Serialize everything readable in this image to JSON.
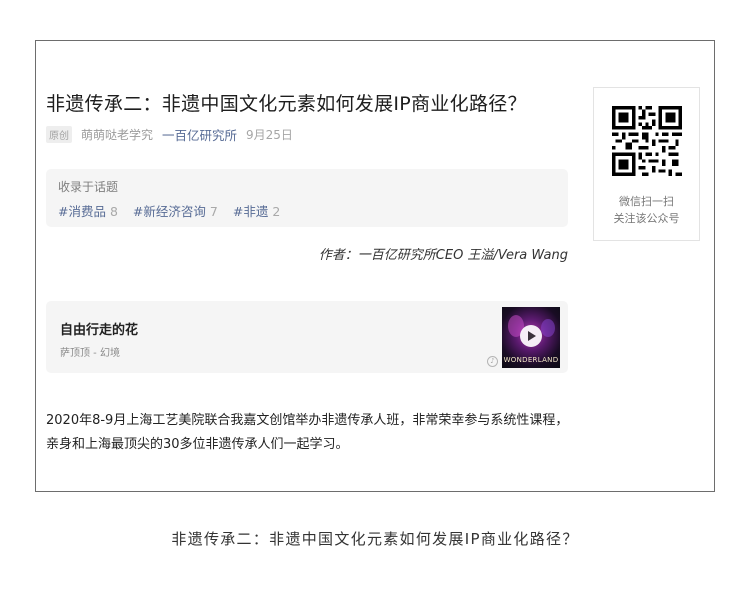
{
  "article": {
    "title": "非遗传承二：非遗中国文化元素如何发展IP商业化路径？",
    "original_badge": "原创",
    "author": "萌萌哒老学究",
    "account": "一百亿研究所",
    "date": "9月25日",
    "topics_label": "收录于话题",
    "topics": [
      {
        "name": "#消费品",
        "count": "8"
      },
      {
        "name": "#新经济咨询",
        "count": "7"
      },
      {
        "name": "#非遗",
        "count": "2"
      }
    ],
    "byline": "作者：一百亿研究所CEO 王溢/Vera Wang",
    "music": {
      "song": "自由行走的花",
      "artist": "萨顶顶 - 幻境",
      "cover_text": "WONDERLAND"
    },
    "paragraph": [
      "2020年8-9月上海工艺美院联合我嘉文创馆举办非遗传承人班，非常荣幸参与系统性课程，",
      "亲身和上海最顶尖的30多位非遗传承人们一起学习。"
    ]
  },
  "qr": {
    "line1": "微信扫一扫",
    "line2": "关注该公众号"
  },
  "caption": "非遗传承二：非遗中国文化元素如何发展IP商业化路径？",
  "colors": {
    "link": "#576b95",
    "card_bg": "#f5f5f5",
    "frame_border": "#6d6d6d"
  }
}
